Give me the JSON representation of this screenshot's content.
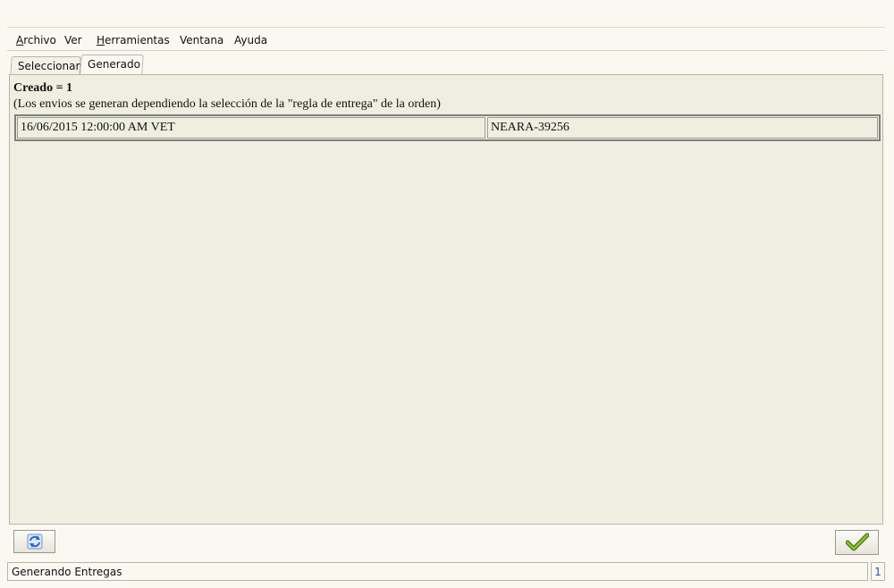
{
  "menu": {
    "archivo": {
      "mnemonic": "A",
      "rest": "rchivo"
    },
    "ver": {
      "label": "Ver"
    },
    "herramientas": {
      "mnemonic": "H",
      "rest": "erramientas"
    },
    "ventana": {
      "label": "Ventana"
    },
    "ayuda": {
      "label": "Ayuda"
    }
  },
  "tabs": [
    {
      "label": "Seleccionar",
      "active": false
    },
    {
      "label": "Generado",
      "active": true
    }
  ],
  "result": {
    "title": "Creado = 1",
    "note": "(Los envios se generan dependiendo la selección de la \"regla de entrega\" de la orden)",
    "rows": [
      {
        "date": "16/06/2015 12:00:00 AM VET",
        "document": "NEARA-39256"
      }
    ]
  },
  "buttons": {
    "refresh_icon": "refresh-icon",
    "ok_icon": "checkmark-icon"
  },
  "status": {
    "text": "Generando Entregas",
    "count": "1"
  },
  "colors": {
    "panel_bg": "#efefe1",
    "window_bg": "#faf8f1",
    "check_green": "#6b9a1c",
    "refresh_blue": "#2f66c4"
  }
}
